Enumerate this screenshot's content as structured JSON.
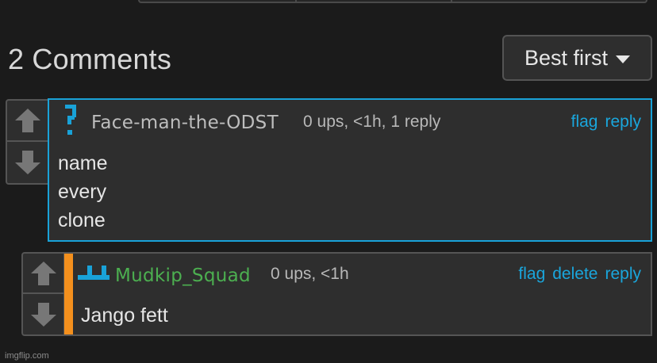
{
  "header": {
    "comment_count_title": "2 Comments",
    "sort": {
      "selected": "Best first"
    }
  },
  "comments": [
    {
      "username": "Face-man-the-ODST",
      "username_color": "#bdbdbd",
      "meta": "0 ups, <1h, 1 reply",
      "actions": [
        "flag",
        "reply"
      ],
      "body_lines": [
        "name",
        "every",
        "clone"
      ],
      "highlighted": true
    },
    {
      "username": "Mudkip_Squad",
      "username_color": "#4caf50",
      "meta": "0 ups, <1h",
      "actions": [
        "flag",
        "delete",
        "reply"
      ],
      "body_lines": [
        "Jango fett"
      ],
      "own_comment": true
    }
  ],
  "colors": {
    "accent": "#19a2d8",
    "own_comment_bar": "#f4901d"
  },
  "footer": {
    "watermark": "imgflip.com"
  }
}
